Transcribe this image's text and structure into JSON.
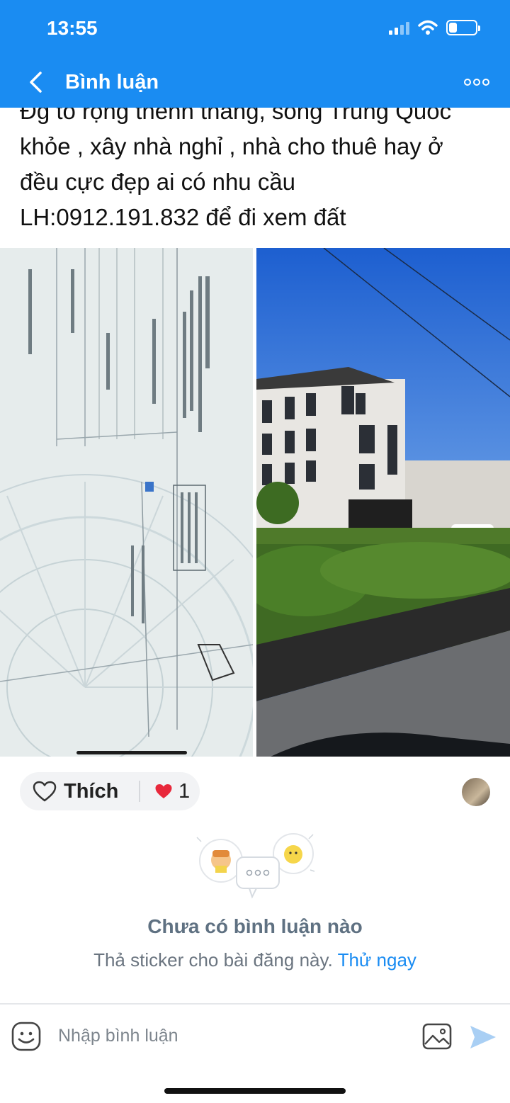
{
  "status_bar": {
    "time": "13:55",
    "battery_level": 0.3
  },
  "header": {
    "title": "Bình luận"
  },
  "post": {
    "text_lines": [
      "Đg to rộng thênh thang, sông Trung Quốc",
      "khỏe , xây nhà nghỉ , nhà cho thuê hay ở",
      "đều cực đẹp ai có nhu cầu",
      "LH:0912.191.832 để đi xem đất"
    ]
  },
  "actions": {
    "like_label": "Thích",
    "reaction_count": "1"
  },
  "empty_state": {
    "title": "Chưa có bình luận nào",
    "subtitle": "Thả sticker cho bài đăng này.",
    "cta": "Thử ngay"
  },
  "composer": {
    "placeholder": "Nhập bình luận"
  },
  "colors": {
    "accent": "#1a8cf2",
    "heart": "#e8283b"
  }
}
